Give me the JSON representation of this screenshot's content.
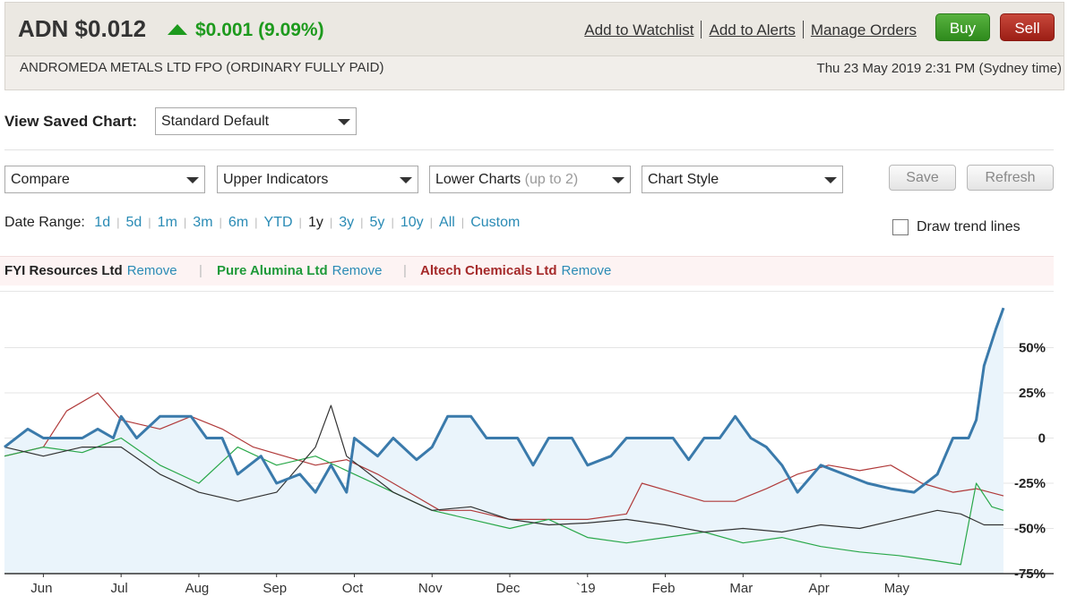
{
  "header": {
    "ticker": "ADN $0.012",
    "change": "$0.001 (9.09%)",
    "links": [
      "Add to Watchlist",
      "Add to Alerts",
      "Manage Orders"
    ],
    "buy_label": "Buy",
    "sell_label": "Sell",
    "company": "ANDROMEDA METALS LTD FPO (ORDINARY FULLY PAID)",
    "datetime": "Thu 23 May 2019 2:31 PM (Sydney time)",
    "colors": {
      "up": "#1d9a1d",
      "buy": "#3a9a2a",
      "sell": "#b22a20"
    }
  },
  "saved_chart": {
    "label": "View Saved Chart:",
    "value": "Standard Default"
  },
  "toolbar": {
    "compare": "Compare",
    "upper": "Upper Indicators",
    "lower": "Lower Charts",
    "lower_hint": "(up to 2)",
    "style": "Chart Style",
    "save": "Save",
    "refresh": "Refresh"
  },
  "date_range": {
    "label": "Date Range:",
    "options": [
      "1d",
      "5d",
      "1m",
      "3m",
      "6m",
      "YTD",
      "1y",
      "3y",
      "5y",
      "10y",
      "All",
      "Custom"
    ],
    "selected": "1y"
  },
  "trend": {
    "label": "Draw trend lines",
    "checked": false
  },
  "compare_list": {
    "remove_label": "Remove",
    "items": [
      {
        "name": "FYI Resources Ltd",
        "color": "#222222"
      },
      {
        "name": "Pure Alumina Ltd",
        "color": "#1f9a3a"
      },
      {
        "name": "Altech Chemicals Ltd",
        "color": "#a52a2a"
      }
    ]
  },
  "chart_data": {
    "type": "line",
    "y_ticks": [
      "50%",
      "25%",
      "0",
      "-25%",
      "-50%",
      "-75%"
    ],
    "y_tick_values": [
      50,
      25,
      0,
      -25,
      -50,
      -75
    ],
    "ylim": [
      -75,
      75
    ],
    "x_ticks": [
      "Jun",
      "Jul",
      "Aug",
      "Sep",
      "Oct",
      "Nov",
      "Dec",
      "`19",
      "Feb",
      "Mar",
      "Apr",
      "May"
    ],
    "x_tick_positions": [
      0.5,
      1.5,
      2.5,
      3.5,
      4.5,
      5.5,
      6.5,
      7.5,
      8.5,
      9.5,
      10.5,
      11.5
    ],
    "xlim": [
      0,
      12.85
    ],
    "series": [
      {
        "name": "ADN",
        "color": "#3a7aab",
        "area": true,
        "width": 3,
        "points": [
          [
            0,
            -5
          ],
          [
            0.3,
            5
          ],
          [
            0.5,
            0
          ],
          [
            0.8,
            0
          ],
          [
            1.0,
            0
          ],
          [
            1.2,
            5
          ],
          [
            1.4,
            0
          ],
          [
            1.5,
            12
          ],
          [
            1.7,
            0
          ],
          [
            2.0,
            12
          ],
          [
            2.4,
            12
          ],
          [
            2.6,
            0
          ],
          [
            2.8,
            0
          ],
          [
            3.0,
            -20
          ],
          [
            3.3,
            -10
          ],
          [
            3.5,
            -25
          ],
          [
            3.8,
            -20
          ],
          [
            4.0,
            -30
          ],
          [
            4.2,
            -15
          ],
          [
            4.4,
            -30
          ],
          [
            4.5,
            0
          ],
          [
            4.8,
            -10
          ],
          [
            5.0,
            0
          ],
          [
            5.3,
            -12
          ],
          [
            5.5,
            -5
          ],
          [
            5.7,
            12
          ],
          [
            6.0,
            12
          ],
          [
            6.2,
            0
          ],
          [
            6.6,
            0
          ],
          [
            6.8,
            -15
          ],
          [
            7.0,
            0
          ],
          [
            7.3,
            0
          ],
          [
            7.5,
            -15
          ],
          [
            7.8,
            -10
          ],
          [
            8.0,
            0
          ],
          [
            8.4,
            0
          ],
          [
            8.6,
            0
          ],
          [
            8.8,
            -12
          ],
          [
            9.0,
            0
          ],
          [
            9.2,
            0
          ],
          [
            9.4,
            12
          ],
          [
            9.6,
            0
          ],
          [
            9.8,
            -5
          ],
          [
            10.0,
            -15
          ],
          [
            10.2,
            -30
          ],
          [
            10.5,
            -15
          ],
          [
            10.8,
            -20
          ],
          [
            11.1,
            -25
          ],
          [
            11.4,
            -28
          ],
          [
            11.7,
            -30
          ],
          [
            12.0,
            -20
          ],
          [
            12.2,
            0
          ],
          [
            12.4,
            0
          ],
          [
            12.5,
            10
          ],
          [
            12.6,
            40
          ],
          [
            12.75,
            60
          ],
          [
            12.85,
            72
          ]
        ]
      },
      {
        "name": "FYI Resources Ltd",
        "color": "#333333",
        "width": 1.2,
        "points": [
          [
            0,
            -5
          ],
          [
            0.5,
            -10
          ],
          [
            1.0,
            -5
          ],
          [
            1.5,
            -5
          ],
          [
            2.0,
            -20
          ],
          [
            2.5,
            -30
          ],
          [
            3.0,
            -35
          ],
          [
            3.5,
            -30
          ],
          [
            4.0,
            -5
          ],
          [
            4.2,
            18
          ],
          [
            4.4,
            -10
          ],
          [
            5.0,
            -30
          ],
          [
            5.5,
            -40
          ],
          [
            6.0,
            -38
          ],
          [
            6.5,
            -45
          ],
          [
            7.0,
            -48
          ],
          [
            7.5,
            -47
          ],
          [
            8.0,
            -45
          ],
          [
            8.5,
            -48
          ],
          [
            9.0,
            -52
          ],
          [
            9.5,
            -50
          ],
          [
            10.0,
            -52
          ],
          [
            10.5,
            -48
          ],
          [
            11.0,
            -50
          ],
          [
            11.5,
            -45
          ],
          [
            12.0,
            -40
          ],
          [
            12.3,
            -42
          ],
          [
            12.6,
            -48
          ],
          [
            12.85,
            -48
          ]
        ]
      },
      {
        "name": "Pure Alumina Ltd",
        "color": "#2aa84a",
        "width": 1.2,
        "points": [
          [
            0,
            -10
          ],
          [
            0.5,
            -5
          ],
          [
            1.0,
            -8
          ],
          [
            1.5,
            0
          ],
          [
            2.0,
            -15
          ],
          [
            2.5,
            -25
          ],
          [
            3.0,
            -5
          ],
          [
            3.5,
            -15
          ],
          [
            4.0,
            -10
          ],
          [
            4.5,
            -20
          ],
          [
            5.0,
            -30
          ],
          [
            5.5,
            -40
          ],
          [
            6.0,
            -45
          ],
          [
            6.5,
            -50
          ],
          [
            7.0,
            -45
          ],
          [
            7.5,
            -55
          ],
          [
            8.0,
            -58
          ],
          [
            8.5,
            -55
          ],
          [
            9.0,
            -52
          ],
          [
            9.5,
            -58
          ],
          [
            10.0,
            -55
          ],
          [
            10.5,
            -60
          ],
          [
            11.0,
            -63
          ],
          [
            11.5,
            -65
          ],
          [
            12.0,
            -68
          ],
          [
            12.3,
            -70
          ],
          [
            12.5,
            -25
          ],
          [
            12.7,
            -38
          ],
          [
            12.85,
            -40
          ]
        ]
      },
      {
        "name": "Altech Chemicals Ltd",
        "color": "#b03a3a",
        "width": 1.2,
        "points": [
          [
            0,
            -10
          ],
          [
            0.5,
            -5
          ],
          [
            0.8,
            15
          ],
          [
            1.2,
            25
          ],
          [
            1.5,
            10
          ],
          [
            2.0,
            5
          ],
          [
            2.4,
            12
          ],
          [
            2.8,
            5
          ],
          [
            3.2,
            -5
          ],
          [
            3.6,
            -10
          ],
          [
            4.0,
            -15
          ],
          [
            4.4,
            -12
          ],
          [
            4.8,
            -20
          ],
          [
            5.2,
            -30
          ],
          [
            5.6,
            -40
          ],
          [
            6.0,
            -40
          ],
          [
            6.5,
            -45
          ],
          [
            7.0,
            -45
          ],
          [
            7.5,
            -45
          ],
          [
            8.0,
            -42
          ],
          [
            8.2,
            -25
          ],
          [
            8.6,
            -30
          ],
          [
            9.0,
            -35
          ],
          [
            9.4,
            -35
          ],
          [
            9.8,
            -28
          ],
          [
            10.2,
            -20
          ],
          [
            10.6,
            -15
          ],
          [
            11.0,
            -18
          ],
          [
            11.4,
            -15
          ],
          [
            11.8,
            -25
          ],
          [
            12.2,
            -30
          ],
          [
            12.5,
            -28
          ],
          [
            12.85,
            -32
          ]
        ]
      }
    ]
  }
}
